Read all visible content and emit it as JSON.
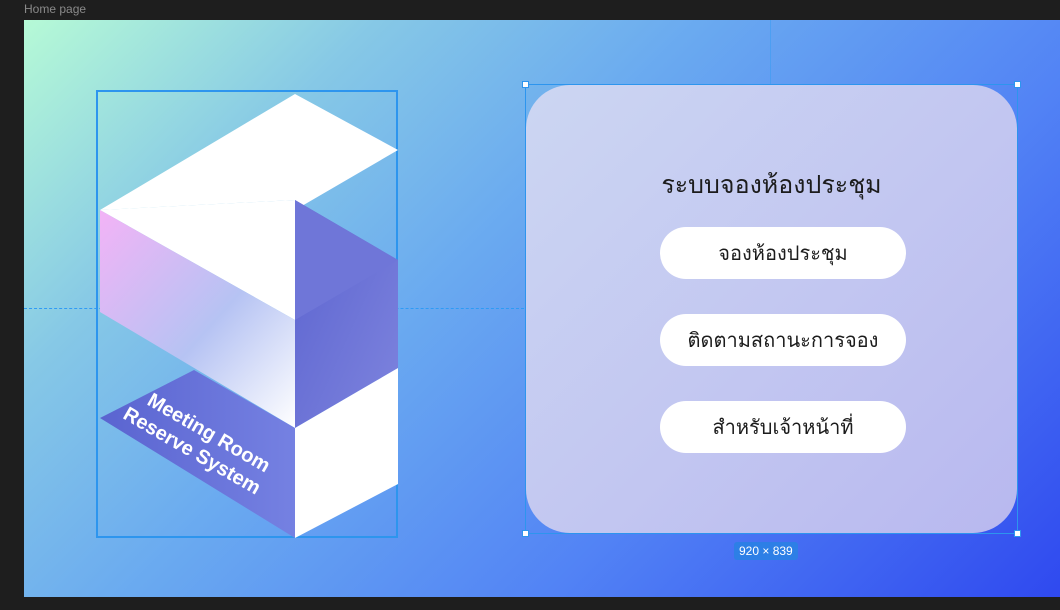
{
  "frame": {
    "label": "Home page"
  },
  "logo": {
    "line1": "Meeting Room",
    "line2": "Reserve System"
  },
  "card": {
    "title": "ระบบจองห้องประชุม",
    "buttons": [
      {
        "label": "จองห้องประชุม"
      },
      {
        "label": "ติดตามสถานะการจอง"
      },
      {
        "label": "สำหรับเจ้าหน้าที่"
      }
    ]
  },
  "selection": {
    "size": "920 × 839"
  },
  "colors": {
    "selection": "#2d95ee",
    "card": "#c6ccf2",
    "button": "#ffffff"
  }
}
